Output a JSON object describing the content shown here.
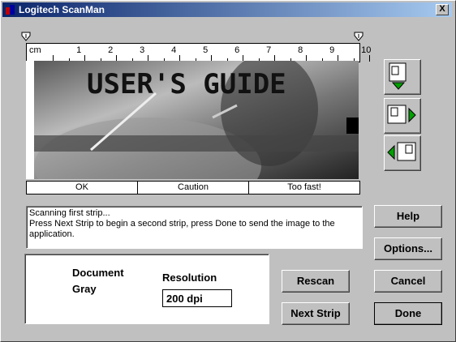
{
  "window": {
    "title": "Logitech ScanMan",
    "close_label": "X"
  },
  "ruler": {
    "unit": "cm",
    "numbers": [
      "1",
      "2",
      "3",
      "4",
      "5",
      "6",
      "7",
      "8",
      "9",
      "10"
    ]
  },
  "scan_preview": {
    "text": "USER'S GUIDE"
  },
  "speed_status": {
    "ok": "OK",
    "caution": "Caution",
    "too_fast": "Too fast!"
  },
  "message": {
    "line1": "Scanning first strip...",
    "line2": "Press Next Strip to begin a second strip, press Done to send the image to the application."
  },
  "info": {
    "document_label": "Document",
    "mode": "Gray",
    "resolution_label": "Resolution",
    "resolution_value": "200 dpi"
  },
  "buttons": {
    "help": "Help",
    "options": "Options...",
    "rescan": "Rescan",
    "cancel": "Cancel",
    "next_strip": "Next Strip",
    "done": "Done"
  },
  "icons": {
    "scan_down": "scan-down-icon",
    "scan_right": "scan-right-icon",
    "scan_left": "scan-left-icon"
  },
  "colors": {
    "title_start": "#0a246a",
    "title_end": "#a6caf0",
    "arrow_green": "#00a000",
    "face": "#c0c0c0"
  }
}
